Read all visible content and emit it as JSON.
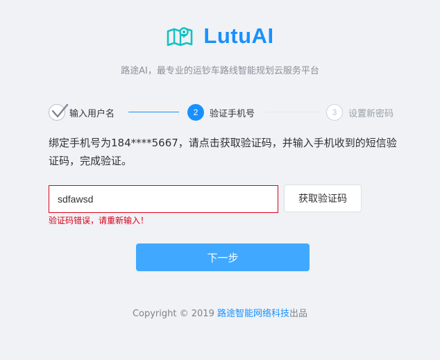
{
  "brand": {
    "name": "LutuAI",
    "subtitle": "路途AI，最专业的运钞车路线智能规划云服务平台",
    "accent_color": "#1890ff"
  },
  "steps": [
    {
      "number": "1",
      "label": "输入用户名",
      "state": "done",
      "icon": "check-icon"
    },
    {
      "number": "2",
      "label": "验证手机号",
      "state": "active"
    },
    {
      "number": "3",
      "label": "设置新密码",
      "state": "pending"
    }
  ],
  "message": "绑定手机号为184****5667，请点击获取验证码，并输入手机收到的短信验证码，完成验证。",
  "code_input": {
    "value": "sdfawsd"
  },
  "get_code_button": "获取验证码",
  "error": {
    "text": "验证码错误，请重新输入！",
    "color": "#d9001b"
  },
  "next_button": "下一步",
  "footer": {
    "copyright": "Copyright",
    "symbol": "©",
    "year": "2019",
    "company": "路途智能网络科技",
    "suffix": "出品"
  }
}
